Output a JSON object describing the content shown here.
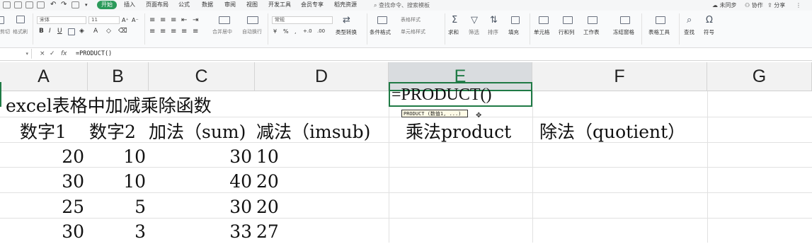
{
  "menu": {
    "tabs": [
      "开始",
      "插入",
      "页面布局",
      "公式",
      "数据",
      "审阅",
      "视图",
      "开发工具",
      "会员专享",
      "稻壳资源"
    ],
    "search_placeholder": "查找命令、搜索模板",
    "right": [
      "未同步",
      "协作",
      "分享"
    ]
  },
  "ribbon": {
    "font_name": "宋体",
    "font_size": "11",
    "number_format": "常规",
    "left_labels": [
      "剪切",
      "格式刷"
    ],
    "merge_label": "合并居中",
    "wrap_label": "自动换行",
    "table_style_label": "表格样式",
    "cell_style_label": "单元格样式",
    "groups": [
      "类型转换",
      "条件格式",
      "求和",
      "筛选",
      "排序",
      "填充",
      "单元格",
      "行和列",
      "工作表",
      "冻结窗格",
      "表格工具",
      "查找",
      "符号"
    ]
  },
  "formula_bar": {
    "name_box": "",
    "cancel": "×",
    "confirm": "✓",
    "fx": "fx",
    "formula": "=PRODUCT()"
  },
  "columns": [
    "A",
    "B",
    "C",
    "D",
    "E",
    "F",
    "G"
  ],
  "selected_column": "E",
  "sheet": {
    "title": "excel表格中加减乘除函数",
    "headers": [
      "数字1",
      "数字2",
      "加法（sum)",
      "减法（imsub)",
      "乘法product",
      "除法（quotient）"
    ],
    "rows": [
      {
        "a": "20",
        "b": "10",
        "c": "30",
        "d": "10"
      },
      {
        "a": "30",
        "b": "10",
        "c": "40",
        "d": "20"
      },
      {
        "a": "25",
        "b": "5",
        "c": "30",
        "d": "20"
      },
      {
        "a": "30",
        "b": "3",
        "c": "33",
        "d": "27"
      }
    ],
    "editing_cell_value": "=PRODUCT()",
    "tooltip": "PRODUCT (数值1, ...)"
  }
}
